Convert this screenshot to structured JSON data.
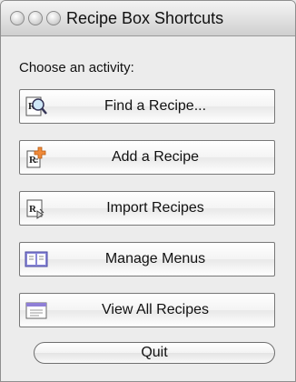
{
  "window": {
    "title": "Recipe Box Shortcuts"
  },
  "prompt": "Choose an activity:",
  "buttons": [
    {
      "label": "Find a Recipe...",
      "icon": "find-recipe-icon"
    },
    {
      "label": "Add a Recipe",
      "icon": "add-recipe-icon"
    },
    {
      "label": "Import Recipes",
      "icon": "import-recipes-icon"
    },
    {
      "label": "Manage Menus",
      "icon": "manage-menus-icon"
    },
    {
      "label": "View All Recipes",
      "icon": "view-all-recipes-icon"
    }
  ],
  "quit_label": "Quit"
}
